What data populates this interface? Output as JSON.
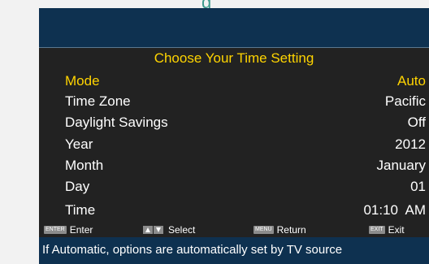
{
  "menu": {
    "title": "Choose Your Time Setting",
    "rows": [
      {
        "label": "Mode",
        "value": "Auto",
        "selected": true
      },
      {
        "label": "Time Zone",
        "value": "Pacific"
      },
      {
        "label": "Daylight Savings",
        "value": "Off"
      },
      {
        "label": "Year",
        "value": "2012"
      },
      {
        "label": "Month",
        "value": "January"
      },
      {
        "label": "Day",
        "value": "01"
      },
      {
        "label": "Time",
        "value": "01:10  AM"
      }
    ]
  },
  "legend": {
    "enter_key": "ENTER",
    "enter_label": "Enter",
    "select_label": "Select",
    "menu_key": "MENU",
    "return_label": "Return",
    "exit_key": "EXIT",
    "exit_label": "Exit"
  },
  "help_text": "If Automatic, options are automatically set by TV source",
  "colors": {
    "header_bar": "#0e3150",
    "menu_background": "#222222",
    "highlight_text": "#ffd400",
    "normal_text": "#ffffff",
    "key_badge": "#8c8c8c"
  },
  "icons": {
    "select_up": "up-arrow-icon",
    "select_down": "down-arrow-icon"
  }
}
